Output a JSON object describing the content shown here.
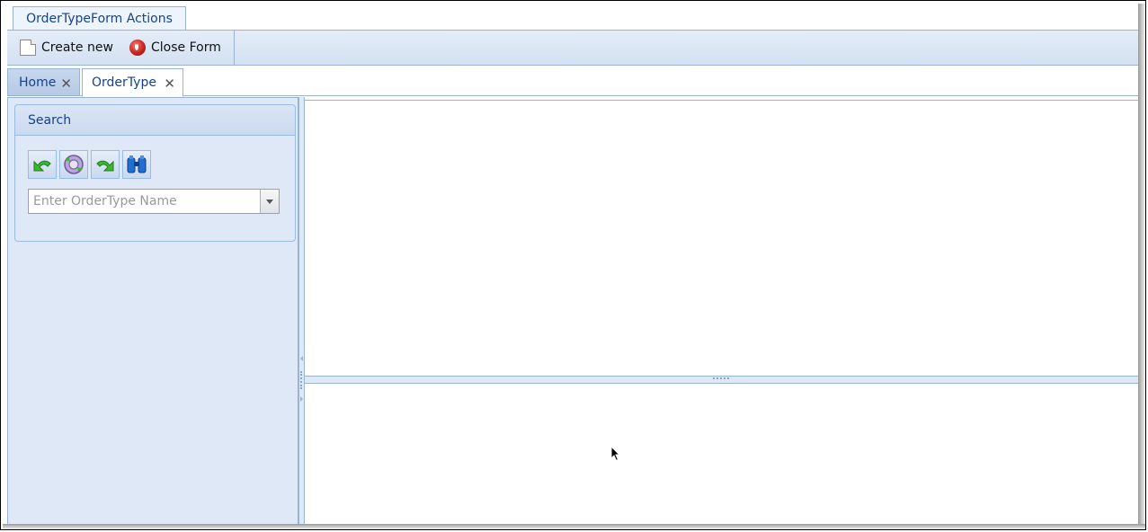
{
  "ribbon": {
    "tab_label": "OrderTypeForm Actions",
    "create_new_label": "Create new",
    "close_form_label": "Close Form"
  },
  "document_tabs": [
    {
      "label": "Home",
      "active": false
    },
    {
      "label": "OrderType",
      "active": true
    }
  ],
  "search_panel": {
    "title": "Search",
    "tools": [
      "undo-arrow-icon",
      "refresh-icon",
      "redo-arrow-icon",
      "binoculars-icon"
    ],
    "ordertype_input": {
      "value": "",
      "placeholder": "Enter OrderType Name"
    }
  },
  "close_glyph": "✕",
  "colors": {
    "accent_text": "#15428b",
    "panel_bg": "#dfe8f6",
    "border": "#9ab3d0"
  }
}
